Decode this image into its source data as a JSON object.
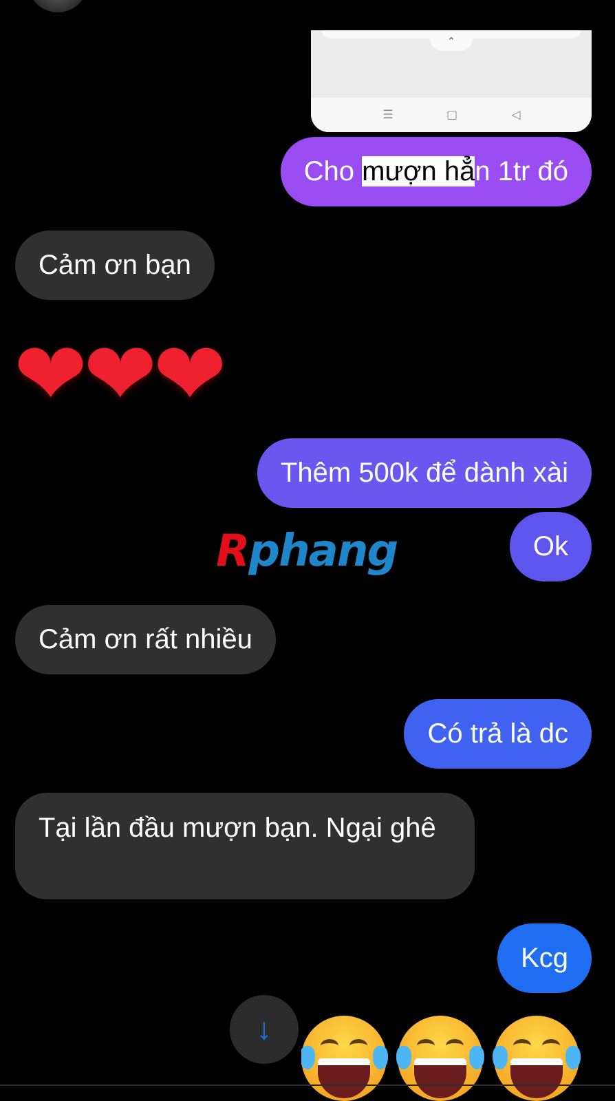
{
  "embedded_screenshot": {
    "pull_tab_glyph": "⌃",
    "nav_buttons": [
      {
        "name": "menu",
        "glyph": "☰"
      },
      {
        "name": "home",
        "glyph": "▢"
      },
      {
        "name": "back",
        "glyph": "◁"
      }
    ]
  },
  "messages": [
    {
      "id": "m1",
      "sender": "me",
      "text_prefix": "Cho ",
      "text_highlighted": "mượn hẳ",
      "text_suffix": "n 1tr đó",
      "bubble_color": "#9a4cf3"
    },
    {
      "id": "m2",
      "sender": "other",
      "text": "Cảm ơn bạn",
      "bubble_color": "#303030"
    },
    {
      "id": "m3",
      "sender": "other",
      "emoji": "❤❤❤"
    },
    {
      "id": "m4",
      "sender": "me",
      "text": "Thêm 500k để dành xài",
      "bubble_color": "#6b56f0"
    },
    {
      "id": "m5",
      "sender": "me",
      "text": "Ok",
      "bubble_color": "#5d55ee"
    },
    {
      "id": "m6",
      "sender": "other",
      "text": "Cảm ơn rất nhiều",
      "bubble_color": "#303030"
    },
    {
      "id": "m7",
      "sender": "me",
      "text": "Có trả là dc",
      "bubble_color": "#3f63f0"
    },
    {
      "id": "m8",
      "sender": "other",
      "text": "Tại lần đầu mượn bạn. Ngại ghê",
      "bubble_color": "#303030"
    },
    {
      "id": "m9",
      "sender": "me",
      "text": "Kcg",
      "bubble_color": "#1f6ef2"
    },
    {
      "id": "m10",
      "sender": "me",
      "emoji": "laughing-with-tears x3"
    }
  ],
  "watermark": {
    "first_letter": "R",
    "rest": "phang"
  },
  "scroll_down_button": {
    "glyph": "↓",
    "color": "#1a73e8"
  }
}
